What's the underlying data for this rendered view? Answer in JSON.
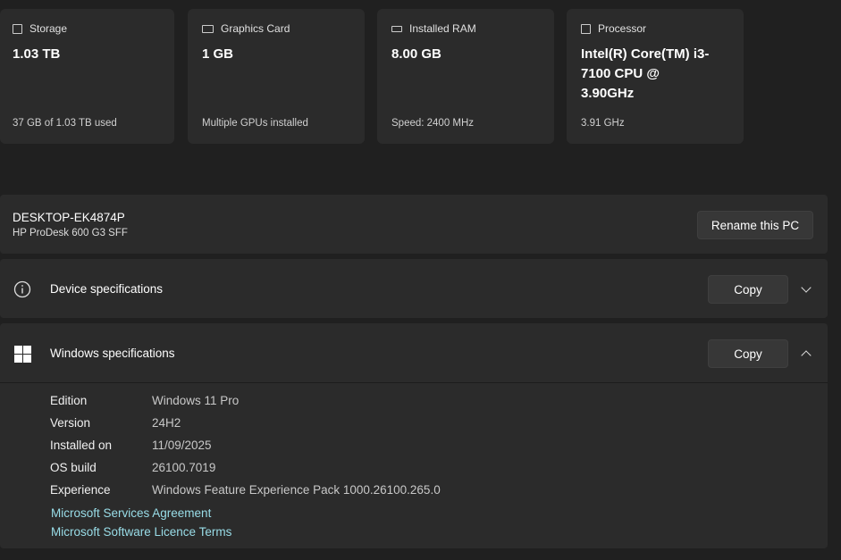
{
  "cards": [
    {
      "title": "Storage",
      "value": "1.03 TB",
      "sub": "37 GB of 1.03 TB used",
      "icon": "storage-icon"
    },
    {
      "title": "Graphics Card",
      "value": "1 GB",
      "sub": "Multiple GPUs installed",
      "icon": "graphics-card-icon"
    },
    {
      "title": "Installed RAM",
      "value": "8.00 GB",
      "sub": "Speed: 2400 MHz",
      "icon": "ram-icon"
    },
    {
      "title": "Processor",
      "value": "Intel(R) Core(TM) i3-7100 CPU @ 3.90GHz",
      "sub": "3.91 GHz",
      "icon": "processor-icon"
    }
  ],
  "pc": {
    "name": "DESKTOP-EK4874P",
    "model": "HP ProDesk 600 G3 SFF",
    "rename_label": "Rename this PC"
  },
  "device_specs": {
    "title": "Device specifications",
    "copy_label": "Copy"
  },
  "windows_specs": {
    "title": "Windows specifications",
    "copy_label": "Copy",
    "rows": [
      {
        "key": "Edition",
        "value": "Windows 11 Pro"
      },
      {
        "key": "Version",
        "value": "24H2"
      },
      {
        "key": "Installed on",
        "value": "11/09/2025"
      },
      {
        "key": "OS build",
        "value": "26100.7019"
      },
      {
        "key": "Experience",
        "value": "Windows Feature Experience Pack 1000.26100.265.0"
      }
    ],
    "links": [
      "Microsoft Services Agreement",
      "Microsoft Software Licence Terms"
    ]
  }
}
